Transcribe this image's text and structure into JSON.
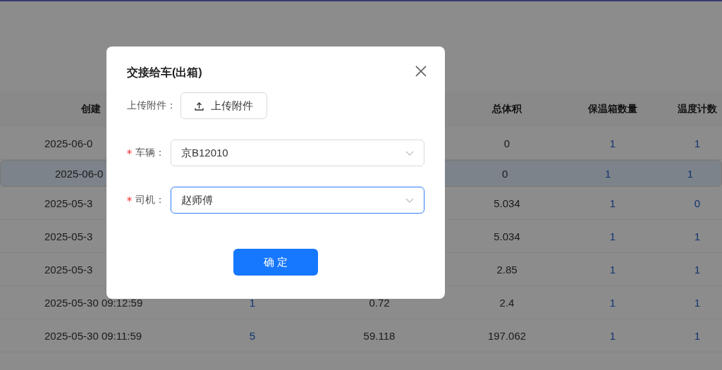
{
  "table": {
    "columns": [
      {
        "label": "创建"
      },
      {},
      {},
      {
        "label": "总体积"
      },
      {
        "label": "保温箱数量"
      },
      {
        "label": "温度计数"
      }
    ],
    "rows": [
      {
        "selected": false,
        "created": "2025-06-0",
        "total_volume": "0",
        "box_count": "1",
        "thermometer_count": "1"
      },
      {
        "selected": true,
        "created": "2025-06-0",
        "total_volume": "0",
        "box_count": "1",
        "thermometer_count": "1"
      },
      {
        "selected": false,
        "created": "2025-05-3",
        "total_volume": "5.034",
        "box_count": "1",
        "thermometer_count": "0"
      },
      {
        "selected": false,
        "created": "2025-05-3",
        "total_volume": "5.034",
        "box_count": "1",
        "thermometer_count": "1"
      },
      {
        "selected": false,
        "created": "2025-05-3",
        "total_volume": "2.85",
        "box_count": "1",
        "thermometer_count": "1"
      },
      {
        "selected": false,
        "created": "2025-05-30 09:12:59",
        "column_3": "1",
        "column_4": "0.72",
        "total_volume": "2.4",
        "box_count": "1",
        "thermometer_count": "1"
      },
      {
        "selected": false,
        "created": "2025-05-30 09:11:59",
        "column_3": "5",
        "column_4": "59.118",
        "total_volume": "197.062",
        "box_count": "1",
        "thermometer_count": "1"
      }
    ]
  },
  "dialog": {
    "title": "交接给车(出箱)",
    "fields": [
      {
        "kind": "upload",
        "label": "上传附件：",
        "required": false,
        "button": "上传附件"
      },
      {
        "kind": "select",
        "label": "车辆：",
        "required": true,
        "value": "京B12010",
        "focused": false
      },
      {
        "kind": "select",
        "label": "司机：",
        "required": true,
        "value": "赵师傅",
        "focused": true
      }
    ],
    "confirm": "确 定"
  }
}
